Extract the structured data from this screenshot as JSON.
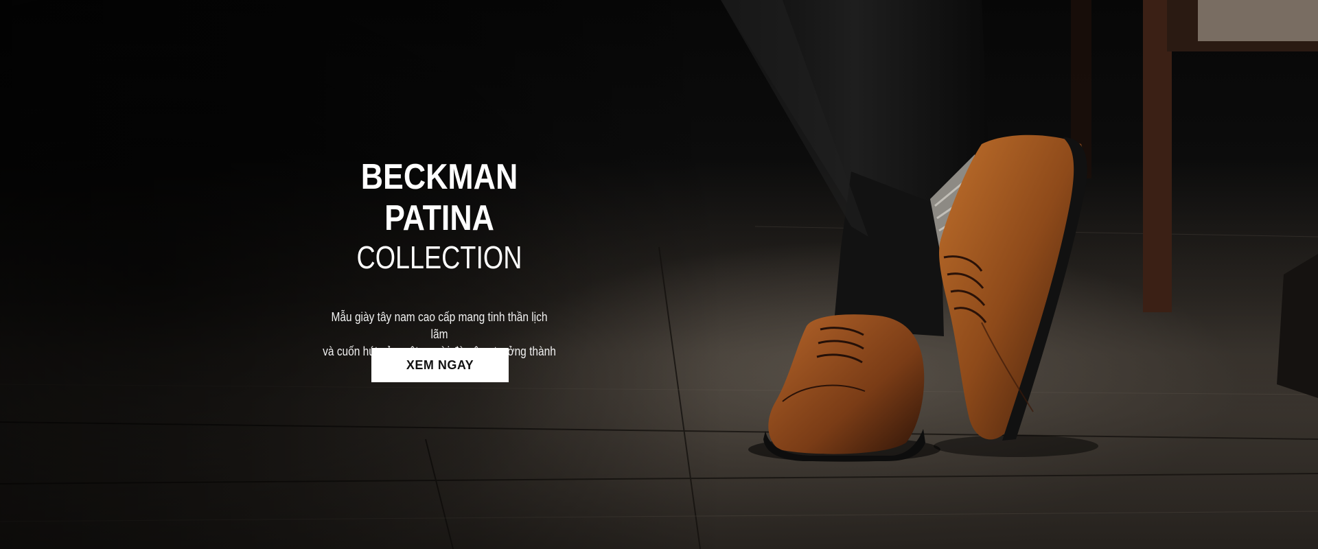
{
  "hero": {
    "title": "BECKMAN PATINA",
    "subtitle": "COLLECTION",
    "description_line1": "Mẫu giày tây nam cao cấp mang tinh thần lịch lãm",
    "description_line2": "và  cuốn hút của một người đàn ông trưởng thành",
    "cta_label": "XEM NGAY"
  },
  "colors": {
    "background": "#0a0a0a",
    "text": "#ffffff",
    "button_bg": "#ffffff",
    "button_text": "#111111",
    "shoe_leather": "#8a4a1c"
  }
}
